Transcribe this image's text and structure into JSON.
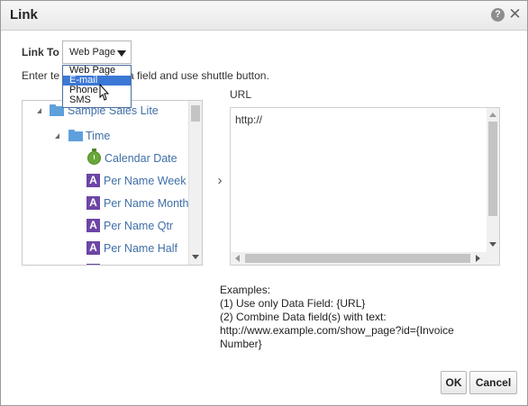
{
  "dialog": {
    "title": "Link"
  },
  "link_to": {
    "label": "Link To",
    "selected": "Web Page",
    "options": [
      "Web Page",
      "E-mail",
      "Phone",
      "SMS"
    ],
    "highlighted": "E-mail"
  },
  "instruction": {
    "before": "Enter te",
    "after": "a field and use shuttle button."
  },
  "tree": {
    "root": "Sample Sales Lite",
    "folder": "Time",
    "items": [
      "Calendar Date",
      "Per Name Week",
      "Per Name Month",
      "Per Name Qtr",
      "Per Name Half"
    ]
  },
  "url": {
    "label": "URL",
    "value": "http://"
  },
  "examples": {
    "heading": "Examples:",
    "line1": "(1) Use only Data Field: {URL}",
    "line2": "(2) Combine Data field(s) with text:",
    "line3": "http://www.example.com/show_page?id={Invoice",
    "line4": "Number}"
  },
  "buttons": {
    "ok": "OK",
    "cancel": "Cancel"
  },
  "icons": {
    "help": "help-icon",
    "close": "close-icon",
    "folder": "folder-icon",
    "time": "timer-icon",
    "attribute": "attribute-a-icon",
    "shuttle": "chevron-right-icon"
  },
  "colors": {
    "tree_text": "#3f6fa8",
    "folder": "#5ea0dc",
    "attribute_icon": "#6d45a6",
    "selected_option": "#3b78d6",
    "timer_icon": "#6aa63a"
  }
}
